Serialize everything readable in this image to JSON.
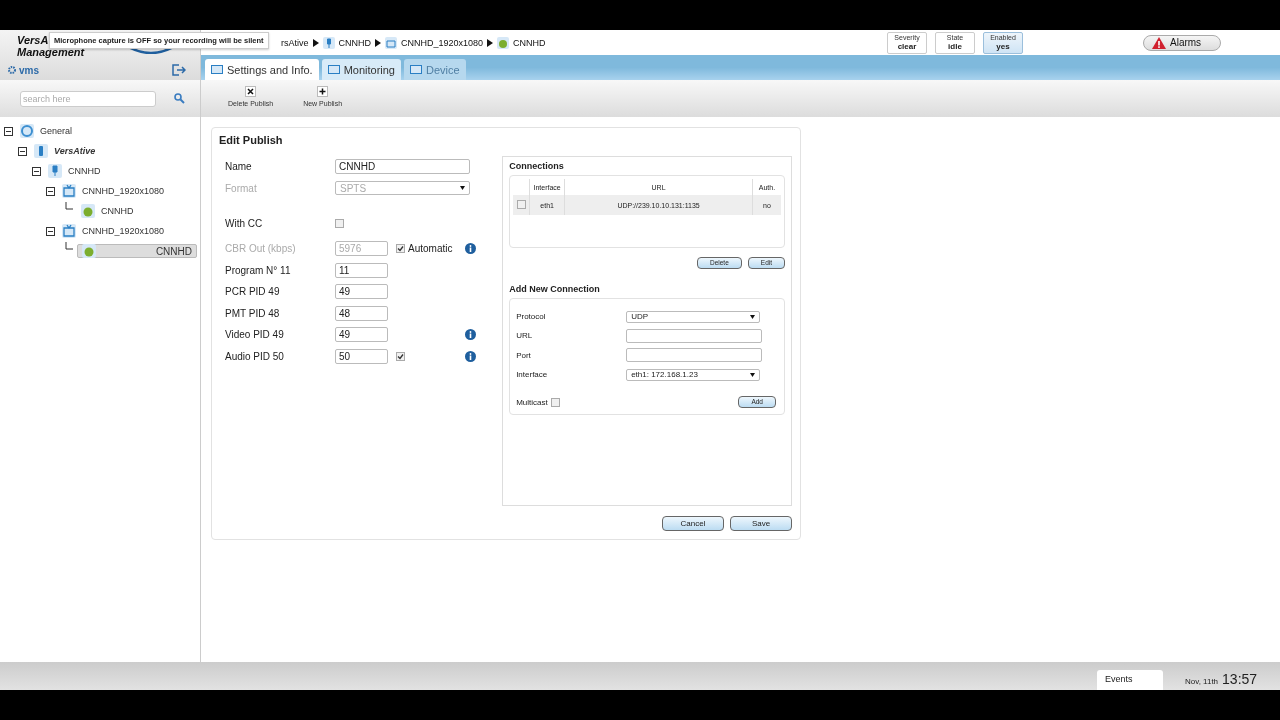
{
  "header": {
    "brand": [
      "VersA",
      "Management"
    ],
    "user": "vms",
    "tooltip": "Microphone capture is OFF so your recording will be silent",
    "breadcrumb": [
      "rsAtive",
      "CNNHD",
      "CNNHD_1920x1080",
      "CNNHD"
    ],
    "status": [
      {
        "label": "Severity",
        "value": "clear",
        "selected": false
      },
      {
        "label": "State",
        "value": "idle",
        "selected": false
      },
      {
        "label": "Enabled",
        "value": "yes",
        "selected": true
      }
    ],
    "alarms": "Alarms"
  },
  "tabs": [
    {
      "label": "Settings and Info.",
      "selected": true,
      "disabled": false
    },
    {
      "label": "Monitoring",
      "selected": false,
      "disabled": false
    },
    {
      "label": "Device",
      "selected": false,
      "disabled": true
    }
  ],
  "search": {
    "placeholder": "search here"
  },
  "toolbar": [
    {
      "label": "Delete Publish",
      "kind": "delete"
    },
    {
      "label": "New Publish",
      "kind": "new"
    }
  ],
  "tree": [
    {
      "label": "General",
      "kind": "globe",
      "expanded": true,
      "selected": false,
      "children": [
        {
          "label": "VersAtive",
          "kind": "device",
          "expanded": true,
          "selected": false,
          "children": [
            {
              "label": "CNNHD",
              "kind": "mic",
              "expanded": true,
              "selected": false,
              "children": [
                {
                  "label": "CNNHD_1920x1080",
                  "kind": "tv",
                  "expanded": true,
                  "selected": false,
                  "children": [
                    {
                      "label": "CNNHD",
                      "kind": "stream",
                      "selected": false
                    }
                  ]
                },
                {
                  "label": "CNNHD_1920x1080",
                  "kind": "tv",
                  "expanded": true,
                  "selected": false,
                  "children": [
                    {
                      "label": "CNNHD",
                      "kind": "stream",
                      "selected": true
                    }
                  ]
                }
              ]
            }
          ]
        }
      ]
    }
  ],
  "edit": {
    "title": "Edit Publish",
    "fields": [
      {
        "kind": "text",
        "label": "Name",
        "value": "CNNHD",
        "disabled": false,
        "wide": true,
        "info": false
      },
      {
        "kind": "select",
        "label": "Format",
        "value": "SPTS",
        "disabled": true,
        "wide": true,
        "info": false
      },
      {
        "kind": "checkbox",
        "label": "With CC",
        "checked": false
      },
      {
        "kind": "text",
        "label": "CBR Out (kbps)",
        "value": "5976",
        "disabled": true,
        "wide": false,
        "check": {
          "checked": true,
          "label": "Automatic"
        },
        "info": true
      },
      {
        "kind": "text",
        "label": "Program N° 11",
        "value": "11",
        "disabled": false,
        "wide": false,
        "info": false
      },
      {
        "kind": "text",
        "label": "PCR PID 49",
        "value": "49",
        "disabled": false,
        "wide": false,
        "info": false
      },
      {
        "kind": "text",
        "label": "PMT PID 48",
        "value": "48",
        "disabled": false,
        "wide": false,
        "info": false
      },
      {
        "kind": "text",
        "label": "Video PID 49",
        "value": "49",
        "disabled": false,
        "wide": false,
        "info": true
      },
      {
        "kind": "text",
        "label": "Audio PID 50",
        "value": "50",
        "disabled": false,
        "wide": false,
        "check": {
          "checked": true
        },
        "info": true
      }
    ],
    "connections": {
      "title": "Connections",
      "columns": [
        "Interface",
        "URL",
        "Auth."
      ],
      "rows": [
        {
          "checked": false,
          "cells": [
            "eth1",
            "UDP://239.10.10.131:1135",
            "no"
          ]
        }
      ],
      "buttons": [
        "Delete",
        "Edit"
      ]
    },
    "add_connection": {
      "title": "Add New Connection",
      "fields": [
        {
          "kind": "select",
          "label": "Protocol",
          "value": "UDP"
        },
        {
          "kind": "text",
          "label": "URL"
        },
        {
          "kind": "text",
          "label": "Port"
        },
        {
          "kind": "select",
          "label": "Interface",
          "value": "eth1: 172.168.1.23"
        }
      ],
      "multicast": {
        "label": "Multicast",
        "checked": false
      },
      "button": "Add"
    },
    "buttons": [
      "Cancel",
      "Save"
    ]
  },
  "status_bar": {
    "events": "Events",
    "date": "Nov, 11th",
    "time": "13:57"
  }
}
